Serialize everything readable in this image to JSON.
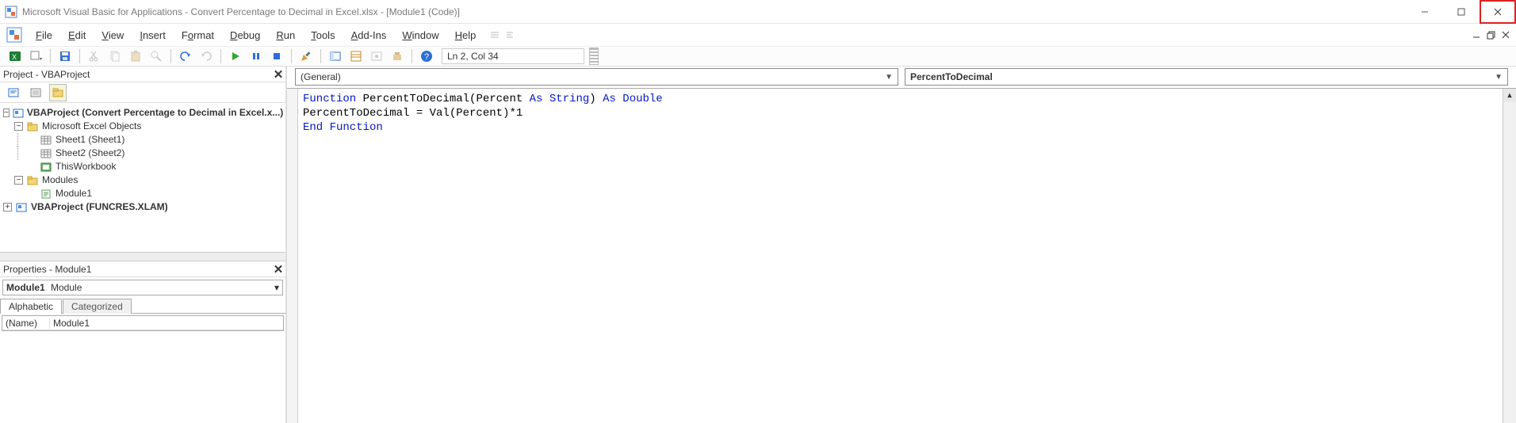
{
  "titlebar": {
    "title": "Microsoft Visual Basic for Applications - Convert Percentage to Decimal in Excel.xlsx - [Module1 (Code)]"
  },
  "menus": {
    "file": "File",
    "edit": "Edit",
    "view": "View",
    "insert": "Insert",
    "format": "Format",
    "debug": "Debug",
    "run": "Run",
    "tools": "Tools",
    "addins": "Add-Ins",
    "window": "Window",
    "help": "Help"
  },
  "toolbar": {
    "cursor_status": "Ln 2, Col 34"
  },
  "project_pane": {
    "title": "Project - VBAProject",
    "nodes": {
      "root1": "VBAProject (Convert Percentage to Decimal in Excel.x...)",
      "excel_objects": "Microsoft Excel Objects",
      "sheet1": "Sheet1 (Sheet1)",
      "sheet2": "Sheet2 (Sheet2)",
      "thiswb": "ThisWorkbook",
      "modules": "Modules",
      "module1": "Module1",
      "root2": "VBAProject (FUNCRES.XLAM)"
    }
  },
  "properties_pane": {
    "title": "Properties - Module1",
    "object_label": "Module1",
    "object_type": "Module",
    "tabs": {
      "alphabetic": "Alphabetic",
      "categorized": "Categorized"
    },
    "rows": {
      "name_key": "(Name)",
      "name_val": "Module1"
    }
  },
  "code_dropdowns": {
    "left": "(General)",
    "right": "PercentToDecimal"
  },
  "code": {
    "l1_kw1": "Function",
    "l1_fn": " PercentToDecimal(Percent ",
    "l1_kw2": "As String",
    "l1_mid": ") ",
    "l1_kw3": "As Double",
    "l2": "PercentToDecimal = Val(Percent)*1",
    "l3_kw": "End Function"
  }
}
